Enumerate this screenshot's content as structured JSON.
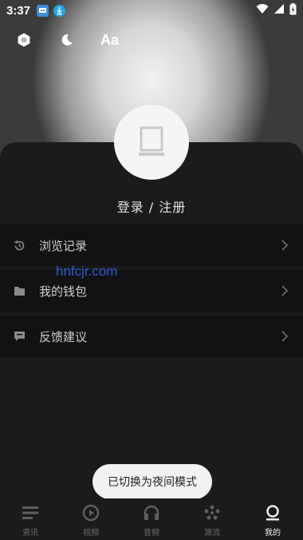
{
  "status_bar": {
    "time": "3:37"
  },
  "header": {
    "tools": {
      "font_size_label": "Aa"
    }
  },
  "profile": {
    "login_label": "登录 / 注册"
  },
  "menu": {
    "items": [
      {
        "label": "浏览记录",
        "icon": "history-icon"
      },
      {
        "label": "我的钱包",
        "icon": "wallet-icon"
      },
      {
        "label": "反馈建议",
        "icon": "feedback-icon"
      }
    ]
  },
  "watermark": "hnfcjr.com",
  "toast": "已切换为夜间模式",
  "bottom_nav": {
    "items": [
      {
        "label": "资讯",
        "icon": "news-icon"
      },
      {
        "label": "视频",
        "icon": "video-icon"
      },
      {
        "label": "音频",
        "icon": "headphones-icon"
      },
      {
        "label": "源流",
        "icon": "source-icon"
      },
      {
        "label": "我的",
        "icon": "profile-icon",
        "active": true
      }
    ]
  },
  "colors": {
    "sheet_bg": "#1b1b1e",
    "row_bg": "#121214",
    "watermark": "#2a5cd6",
    "toast_bg": "#f4f1f4"
  }
}
